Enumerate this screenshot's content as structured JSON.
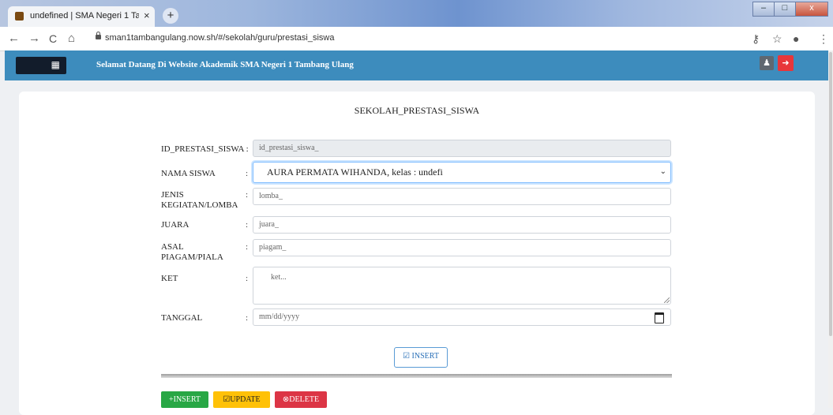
{
  "browser": {
    "tab_title": "undefined | SMA Negeri 1 Tamba",
    "tab_close": "×",
    "new_tab": "+",
    "url": "sman1tambangulang.now.sh/#/sekolah/guru/prestasi_siswa",
    "nav": {
      "back": "←",
      "forward": "→",
      "reload": "C",
      "home": "⌂"
    },
    "toolbar_icons": {
      "key": "⚷",
      "star": "☆",
      "profile": "●",
      "menu": "⋮"
    },
    "window_buttons": {
      "minimize": "–",
      "maximize": "□",
      "close": "x"
    }
  },
  "appbar": {
    "welcome": "Selamat Datang Di Website Akademik SMA Negeri 1 Tambang Ulang",
    "menu_icon": "▦",
    "user_icon": "♟",
    "logout_icon": "➜",
    "bg_color": "#3d8cbd"
  },
  "form": {
    "title": "SEKOLAH_PRESTASI_SISWA",
    "colon": ":",
    "fields": {
      "id_label": "ID_PRESTASI_SISWA :",
      "id_placeholder": "id_prestasi_siswa_",
      "nama_label": "NAMA SISWA",
      "nama_value": "AURA PERMATA WIHANDA, kelas : undefi",
      "jenis_label": "JENIS KEGIATAN/LOMBA",
      "jenis_placeholder": "lomba_",
      "juara_label": "JUARA",
      "juara_placeholder": "juara_",
      "asal_label": "ASAL PIAGAM/PIALA",
      "asal_placeholder": "piagam_",
      "ket_label": "KET",
      "ket_placeholder": "ket...",
      "tanggal_label": "TANGGAL",
      "tanggal_placeholder": "mm/dd/yyyy"
    },
    "insert_button": "☑ INSERT"
  },
  "actions": {
    "insert": "+INSERT",
    "update": "☑UPDATE",
    "delete": "⊗DELETE",
    "colors": {
      "insert": "#28a745",
      "update": "#ffc107",
      "delete": "#dc3545"
    }
  }
}
